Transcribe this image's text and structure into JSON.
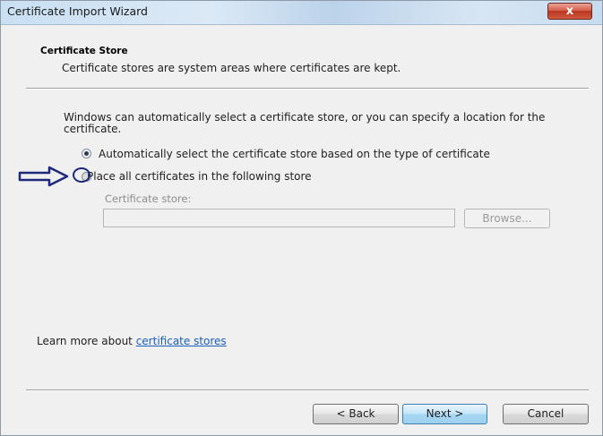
{
  "window": {
    "title": "Certificate Import Wizard",
    "close_glyph": "x"
  },
  "header": {
    "title": "Certificate Store",
    "description": "Certificate stores are system areas where certificates are kept."
  },
  "body": {
    "intro": "Windows can automatically select a certificate store, or you can specify a location for the certificate.",
    "options": [
      {
        "label": "Automatically select the certificate store based on the type of certificate",
        "selected": true
      },
      {
        "label": "Place all certificates in the following store",
        "selected": false
      }
    ],
    "store_field": {
      "label": "Certificate store:",
      "value": "",
      "enabled": false
    },
    "browse_label": "Browse..."
  },
  "footer": {
    "learn_prefix": "Learn more about ",
    "learn_link": "certificate stores",
    "back_label": "< Back",
    "next_label": "Next >",
    "cancel_label": "Cancel"
  },
  "annotation": {
    "arrow_color": "#1d2a7a",
    "arrow_icon": "right-arrow-icon"
  }
}
